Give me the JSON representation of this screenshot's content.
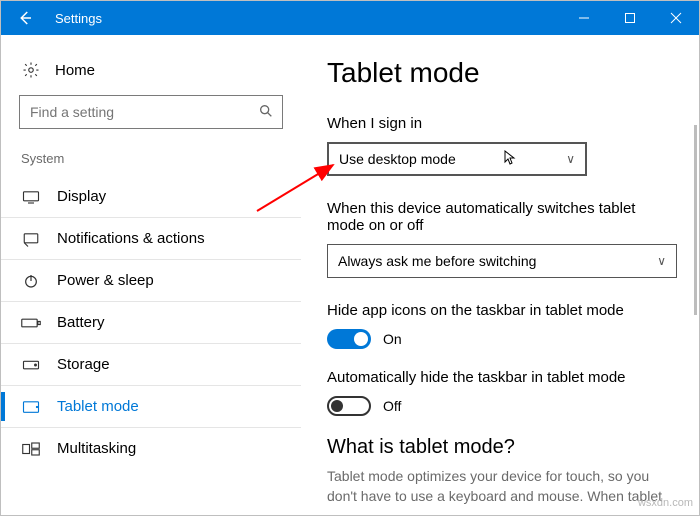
{
  "window": {
    "title": "Settings"
  },
  "sidebar": {
    "home": "Home",
    "search_placeholder": "Find a setting",
    "group": "System",
    "items": [
      {
        "label": "Display"
      },
      {
        "label": "Notifications & actions"
      },
      {
        "label": "Power & sleep"
      },
      {
        "label": "Battery"
      },
      {
        "label": "Storage"
      },
      {
        "label": "Tablet mode"
      },
      {
        "label": "Multitasking"
      }
    ]
  },
  "content": {
    "heading": "Tablet mode",
    "signin_label": "When I sign in",
    "signin_value": "Use desktop mode",
    "switch_label": "When this device automatically switches tablet mode on or off",
    "switch_value": "Always ask me before switching",
    "hide_icons_label": "Hide app icons on the taskbar in tablet mode",
    "hide_icons_state": "On",
    "auto_hide_label": "Automatically hide the taskbar in tablet mode",
    "auto_hide_state": "Off",
    "subheading": "What is tablet mode?",
    "subtext": "Tablet mode optimizes your device for touch, so you don't have to use a keyboard and mouse. When tablet"
  },
  "watermark": "wsxdn.com"
}
